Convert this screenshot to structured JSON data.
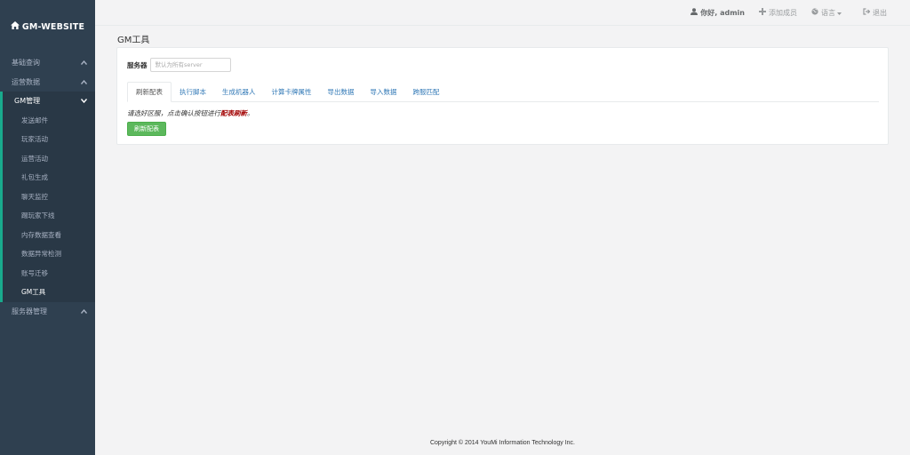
{
  "brand": {
    "title": "GM-WEBSITE",
    "icon": "home-icon"
  },
  "sidebar": {
    "groups": [
      {
        "label": "基础查询",
        "chevron": "▲"
      },
      {
        "label": "运营数据",
        "chevron": "▲"
      },
      {
        "label": "GM管理",
        "chevron": "▼"
      },
      {
        "label": "服务器管理",
        "chevron": "▲"
      }
    ],
    "gm_items": [
      {
        "label": "发送邮件"
      },
      {
        "label": "玩家活动"
      },
      {
        "label": "运营活动"
      },
      {
        "label": "礼包生成"
      },
      {
        "label": "聊天监控"
      },
      {
        "label": "踢玩家下线"
      },
      {
        "label": "内存数据查看"
      },
      {
        "label": "数据异常检测"
      },
      {
        "label": "账号迁移"
      },
      {
        "label": "GM工具"
      }
    ]
  },
  "topbar": {
    "greeting": "你好, admin",
    "add_member": "添加成员",
    "language": "语言",
    "logout": "退出"
  },
  "main": {
    "title": "GM工具",
    "server_label": "服务器",
    "server_placeholder": "默认为所有server",
    "tabs": [
      {
        "label": "刷新配表"
      },
      {
        "label": "执行脚本"
      },
      {
        "label": "生成机器人"
      },
      {
        "label": "计算卡牌属性"
      },
      {
        "label": "导出数据"
      },
      {
        "label": "导入数据"
      },
      {
        "label": "跨服匹配"
      }
    ],
    "hint_prefix": "请选好区服，点击确认按钮进行",
    "hint_emph": "配表刷新",
    "hint_suffix": "。",
    "refresh_button": "刷新配表"
  },
  "footer": {
    "copyright": "Copyright © 2014 YouMi Information Technology Inc."
  },
  "colors": {
    "sidebar_bg": "#2f4050",
    "accent": "#19aa8d",
    "button_green": "#5cb85c",
    "link": "#337ab7",
    "emph": "#a10000"
  }
}
